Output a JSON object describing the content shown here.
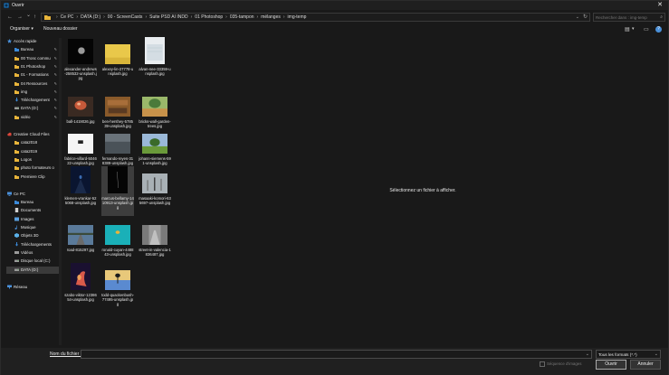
{
  "window": {
    "title": "Ouvrir",
    "close_glyph": "✕"
  },
  "nav": {
    "back": "←",
    "forward": "→",
    "recent": "⌄",
    "up": "↑"
  },
  "address": {
    "breadcrumbs": [
      "Ce PC",
      "DATA (D:)",
      "00 - ScreenCasts",
      "Suite PSD AI INDD",
      "01 Photoshop",
      "035-tampon",
      "mélanges",
      "img-temp"
    ],
    "separator": "›",
    "dropdown": "⌄",
    "refresh": "↻"
  },
  "search": {
    "placeholder": "Rechercher dans : img-temp",
    "icon": "⌕"
  },
  "toolbar": {
    "organize": "Organiser ▾",
    "new_folder": "Nouveau dossier",
    "view_icon": "▤",
    "view_dd": "▾",
    "pane_icon": "▭",
    "help_icon": "?"
  },
  "sidebar": [
    {
      "label": "Accès rapide",
      "icon": "star-icon",
      "color": "#4a90d9",
      "level": 0,
      "pin": false
    },
    {
      "label": "Bureau",
      "icon": "folder-icon",
      "color": "#3b8ad9",
      "level": 1,
      "pin": true
    },
    {
      "label": "00 Tronc commu",
      "icon": "folder-icon",
      "color": "#e8b43a",
      "level": 1,
      "pin": true
    },
    {
      "label": "01 Photoshop",
      "icon": "folder-icon",
      "color": "#e8b43a",
      "level": 1,
      "pin": true
    },
    {
      "label": "01 - Formations",
      "icon": "folder-icon",
      "color": "#e8b43a",
      "level": 1,
      "pin": true
    },
    {
      "label": "04 Ressources",
      "icon": "folder-icon",
      "color": "#e8b43a",
      "level": 1,
      "pin": true
    },
    {
      "label": "img",
      "icon": "folder-icon",
      "color": "#e8b43a",
      "level": 1,
      "pin": true
    },
    {
      "label": "Téléchargement",
      "icon": "download-icon",
      "color": "#3b8ad9",
      "level": 1,
      "pin": true
    },
    {
      "label": "DATA (D:)",
      "icon": "drive-icon",
      "color": "#9a9a9a",
      "level": 1,
      "pin": true
    },
    {
      "label": "vidéo",
      "icon": "folder-icon",
      "color": "#e8b43a",
      "level": 1,
      "pin": true
    },
    {
      "label": "",
      "spacer": true
    },
    {
      "label": "Creative Cloud Files",
      "icon": "cloud-icon",
      "color": "#d9463b",
      "level": 0,
      "pin": false
    },
    {
      "label": "cata2018",
      "icon": "folder-icon",
      "color": "#e8b43a",
      "level": 1,
      "pin": false
    },
    {
      "label": "cata2019",
      "icon": "folder-icon",
      "color": "#e8b43a",
      "level": 1,
      "pin": false
    },
    {
      "label": "Logos",
      "icon": "folder-icon",
      "color": "#e8b43a",
      "level": 1,
      "pin": false
    },
    {
      "label": "photo formateurs o",
      "icon": "folder-icon",
      "color": "#e8b43a",
      "level": 1,
      "pin": false
    },
    {
      "label": "Premiere Clip",
      "icon": "folder-icon",
      "color": "#e8b43a",
      "level": 1,
      "pin": false
    },
    {
      "label": "",
      "spacer": true
    },
    {
      "label": "Ce PC",
      "icon": "computer-icon",
      "color": "#4a90d9",
      "level": 0,
      "pin": false
    },
    {
      "label": "Bureau",
      "icon": "folder-icon",
      "color": "#3b8ad9",
      "level": 1,
      "pin": false
    },
    {
      "label": "Documents",
      "icon": "documents-icon",
      "color": "#cfcfcf",
      "level": 1,
      "pin": false
    },
    {
      "label": "Images",
      "icon": "images-icon",
      "color": "#5aa0e0",
      "level": 1,
      "pin": false
    },
    {
      "label": "Musique",
      "icon": "music-icon",
      "color": "#4a90d9",
      "level": 1,
      "pin": false
    },
    {
      "label": "Objets 3D",
      "icon": "cube-icon",
      "color": "#5ab0e8",
      "level": 1,
      "pin": false
    },
    {
      "label": "Téléchargements",
      "icon": "download-icon",
      "color": "#3b8ad9",
      "level": 1,
      "pin": false
    },
    {
      "label": "Vidéos",
      "icon": "video-icon",
      "color": "#9a9a9a",
      "level": 1,
      "pin": false
    },
    {
      "label": "Disque local (C:)",
      "icon": "drive-icon",
      "color": "#9a9a9a",
      "level": 1,
      "pin": false
    },
    {
      "label": "DATA (D:)",
      "icon": "drive-icon",
      "color": "#9a9a9a",
      "level": 1,
      "pin": false,
      "selected": true
    },
    {
      "label": "",
      "spacer": true
    },
    {
      "label": "Réseau",
      "icon": "network-icon",
      "color": "#4a90d9",
      "level": 0,
      "pin": false
    }
  ],
  "files": [
    {
      "name": "alexander-andrews-258532-unsplash.jpg",
      "style": "moon"
    },
    {
      "name": "alexey-lin-27778-unsplash.jpg",
      "style": "yellow"
    },
    {
      "name": "alvan-nee-33359-unsplash.jpg",
      "style": "white"
    },
    {
      "name": "ball-1419026.jpg",
      "style": "ball"
    },
    {
      "name": "ben-hershey-578539-unsplash.jpg",
      "style": "wood"
    },
    {
      "name": "bricks-wall-garden-trees.jpg",
      "style": "tree"
    },
    {
      "name": "fabrice-villard-504622-unsplash.jpg",
      "style": "bw"
    },
    {
      "name": "fernando-reyes-318389-unsplash.jpg",
      "style": "grey"
    },
    {
      "name": "johann-siemens-591-unsplash.jpg",
      "style": "field"
    },
    {
      "name": "klemen-vrankar-525068-unsplash.jpg",
      "style": "nightsky"
    },
    {
      "name": "marcus-bellamy-1410913-unsplash.jpg",
      "style": "dark",
      "selected": true
    },
    {
      "name": "masaaki-komori-635697-unsplash.jpg",
      "style": "mist"
    },
    {
      "name": "road-815297.jpg",
      "style": "road"
    },
    {
      "name": "ronald-cuyan-448843-unsplash.jpg",
      "style": "teal"
    },
    {
      "name": "street-in-valencia-1836487.jpg",
      "style": "street"
    },
    {
      "name": "szabo-viktor-1238654-unsplash.jpg",
      "style": "fire"
    },
    {
      "name": "todd-quackenbush-77495-unsplash.jpg",
      "style": "sunset"
    }
  ],
  "preview": {
    "message": "Sélectionnez un fichier à afficher."
  },
  "bottom": {
    "filename_label": "Nom du fichier :",
    "filename_value": "",
    "filetype": "Tous les formats (*.*)",
    "sequence_label": "Séquence d'images",
    "open_button": "Ouvrir",
    "cancel_button": "Annuler",
    "dropdown": "⌄"
  }
}
